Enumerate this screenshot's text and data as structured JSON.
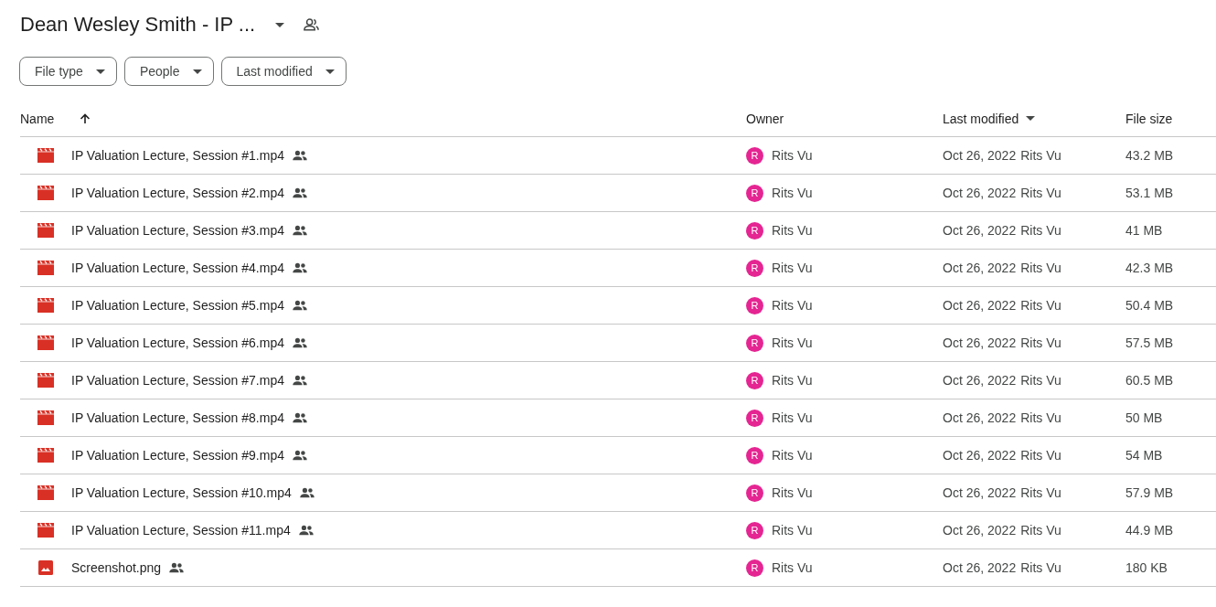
{
  "header": {
    "title": "Dean Wesley Smith - IP ..."
  },
  "filters": [
    "File type",
    "People",
    "Last modified"
  ],
  "table": {
    "columns": [
      {
        "label": "Name",
        "sorted": true,
        "descending": false
      },
      {
        "label": "Owner",
        "sorted": false
      },
      {
        "label": "Last modified",
        "sorted": true,
        "descending": true
      },
      {
        "label": "File size",
        "sorted": false
      }
    ],
    "rows": [
      {
        "kind": "video",
        "name": "IP Valuation Lecture, Session #1.mp4",
        "shared": true,
        "owner_avatar": "R",
        "owner": "Rits Vu",
        "modified": "Oct 26, 2022",
        "modified_by": "Rits Vu",
        "size": "43.2 MB"
      },
      {
        "kind": "video",
        "name": "IP Valuation Lecture, Session #2.mp4",
        "shared": true,
        "owner_avatar": "R",
        "owner": "Rits Vu",
        "modified": "Oct 26, 2022",
        "modified_by": "Rits Vu",
        "size": "53.1 MB"
      },
      {
        "kind": "video",
        "name": "IP Valuation Lecture, Session #3.mp4",
        "shared": true,
        "owner_avatar": "R",
        "owner": "Rits Vu",
        "modified": "Oct 26, 2022",
        "modified_by": "Rits Vu",
        "size": "41 MB"
      },
      {
        "kind": "video",
        "name": "IP Valuation Lecture, Session #4.mp4",
        "shared": true,
        "owner_avatar": "R",
        "owner": "Rits Vu",
        "modified": "Oct 26, 2022",
        "modified_by": "Rits Vu",
        "size": "42.3 MB"
      },
      {
        "kind": "video",
        "name": "IP Valuation Lecture, Session #5.mp4",
        "shared": true,
        "owner_avatar": "R",
        "owner": "Rits Vu",
        "modified": "Oct 26, 2022",
        "modified_by": "Rits Vu",
        "size": "50.4 MB"
      },
      {
        "kind": "video",
        "name": "IP Valuation Lecture, Session #6.mp4",
        "shared": true,
        "owner_avatar": "R",
        "owner": "Rits Vu",
        "modified": "Oct 26, 2022",
        "modified_by": "Rits Vu",
        "size": "57.5 MB"
      },
      {
        "kind": "video",
        "name": "IP Valuation Lecture, Session #7.mp4",
        "shared": true,
        "owner_avatar": "R",
        "owner": "Rits Vu",
        "modified": "Oct 26, 2022",
        "modified_by": "Rits Vu",
        "size": "60.5 MB"
      },
      {
        "kind": "video",
        "name": "IP Valuation Lecture, Session #8.mp4",
        "shared": true,
        "owner_avatar": "R",
        "owner": "Rits Vu",
        "modified": "Oct 26, 2022",
        "modified_by": "Rits Vu",
        "size": "50 MB"
      },
      {
        "kind": "video",
        "name": "IP Valuation Lecture, Session #9.mp4",
        "shared": true,
        "owner_avatar": "R",
        "owner": "Rits Vu",
        "modified": "Oct 26, 2022",
        "modified_by": "Rits Vu",
        "size": "54 MB"
      },
      {
        "kind": "video",
        "name": "IP Valuation Lecture, Session #10.mp4",
        "shared": true,
        "owner_avatar": "R",
        "owner": "Rits Vu",
        "modified": "Oct 26, 2022",
        "modified_by": "Rits Vu",
        "size": "57.9 MB"
      },
      {
        "kind": "video",
        "name": "IP Valuation Lecture, Session #11.mp4",
        "shared": true,
        "owner_avatar": "R",
        "owner": "Rits Vu",
        "modified": "Oct 26, 2022",
        "modified_by": "Rits Vu",
        "size": "44.9 MB"
      },
      {
        "kind": "image",
        "name": "Screenshot.png",
        "shared": true,
        "owner_avatar": "R",
        "owner": "Rits Vu",
        "modified": "Oct 26, 2022",
        "modified_by": "Rits Vu",
        "size": "180 KB"
      }
    ]
  }
}
